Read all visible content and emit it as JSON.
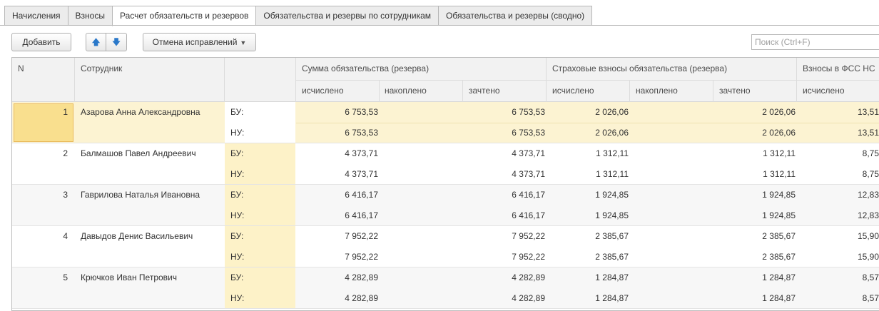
{
  "tabs": [
    {
      "label": "Начисления"
    },
    {
      "label": "Взносы"
    },
    {
      "label": "Расчет обязательств и резервов"
    },
    {
      "label": "Обязательства и резервы по сотрудникам"
    },
    {
      "label": "Обязательства и резервы (сводно)"
    }
  ],
  "active_tab": 2,
  "toolbar": {
    "add_label": "Добавить",
    "move_up_icon": "arrow-up-icon",
    "move_down_icon": "arrow-down-icon",
    "undo_label": "Отмена исправлений",
    "search_placeholder": "Поиск (Ctrl+F)"
  },
  "table": {
    "headers": {
      "n": "N",
      "employee": "Сотрудник",
      "group1": "Сумма обязательства (резерва)",
      "group2": "Страховые взносы обязательства (резерва)",
      "group3": "Взносы в ФСС НС",
      "calc": "исчислено",
      "accum": "накоплено",
      "offset": "зачтено"
    },
    "rows": [
      {
        "n": "1",
        "name": "Азарова Анна Александровна",
        "lines": [
          {
            "type": "БУ:",
            "sum_calc": "6 753,53",
            "sum_accum": "",
            "sum_offset": "6 753,53",
            "ins_calc": "2 026,06",
            "ins_accum": "",
            "ins_offset": "2 026,06",
            "fss_calc": "13,51"
          },
          {
            "type": "НУ:",
            "sum_calc": "6 753,53",
            "sum_accum": "",
            "sum_offset": "6 753,53",
            "ins_calc": "2 026,06",
            "ins_accum": "",
            "ins_offset": "2 026,06",
            "fss_calc": "13,51"
          }
        ]
      },
      {
        "n": "2",
        "name": "Балмашов Павел Андреевич",
        "lines": [
          {
            "type": "БУ:",
            "sum_calc": "4 373,71",
            "sum_accum": "",
            "sum_offset": "4 373,71",
            "ins_calc": "1 312,11",
            "ins_accum": "",
            "ins_offset": "1 312,11",
            "fss_calc": "8,75"
          },
          {
            "type": "НУ:",
            "sum_calc": "4 373,71",
            "sum_accum": "",
            "sum_offset": "4 373,71",
            "ins_calc": "1 312,11",
            "ins_accum": "",
            "ins_offset": "1 312,11",
            "fss_calc": "8,75"
          }
        ]
      },
      {
        "n": "3",
        "name": "Гаврилова Наталья Ивановна",
        "lines": [
          {
            "type": "БУ:",
            "sum_calc": "6 416,17",
            "sum_accum": "",
            "sum_offset": "6 416,17",
            "ins_calc": "1 924,85",
            "ins_accum": "",
            "ins_offset": "1 924,85",
            "fss_calc": "12,83"
          },
          {
            "type": "НУ:",
            "sum_calc": "6 416,17",
            "sum_accum": "",
            "sum_offset": "6 416,17",
            "ins_calc": "1 924,85",
            "ins_accum": "",
            "ins_offset": "1 924,85",
            "fss_calc": "12,83"
          }
        ]
      },
      {
        "n": "4",
        "name": "Давыдов Денис Васильевич",
        "lines": [
          {
            "type": "БУ:",
            "sum_calc": "7 952,22",
            "sum_accum": "",
            "sum_offset": "7 952,22",
            "ins_calc": "2 385,67",
            "ins_accum": "",
            "ins_offset": "2 385,67",
            "fss_calc": "15,90"
          },
          {
            "type": "НУ:",
            "sum_calc": "7 952,22",
            "sum_accum": "",
            "sum_offset": "7 952,22",
            "ins_calc": "2 385,67",
            "ins_accum": "",
            "ins_offset": "2 385,67",
            "fss_calc": "15,90"
          }
        ]
      },
      {
        "n": "5",
        "name": "Крючков Иван Петрович",
        "lines": [
          {
            "type": "БУ:",
            "sum_calc": "4 282,89",
            "sum_accum": "",
            "sum_offset": "4 282,89",
            "ins_calc": "1 284,87",
            "ins_accum": "",
            "ins_offset": "1 284,87",
            "fss_calc": "8,57"
          },
          {
            "type": "НУ:",
            "sum_calc": "4 282,89",
            "sum_accum": "",
            "sum_offset": "4 282,89",
            "ins_calc": "1 284,87",
            "ins_accum": "",
            "ins_offset": "1 284,87",
            "fss_calc": "8,57"
          }
        ]
      }
    ]
  },
  "colors": {
    "selected_row": "#fcf3d2",
    "selected_cell": "#f9df8e",
    "type_column": "#fdf2c8",
    "accent_arrow": "#2a78c9"
  }
}
